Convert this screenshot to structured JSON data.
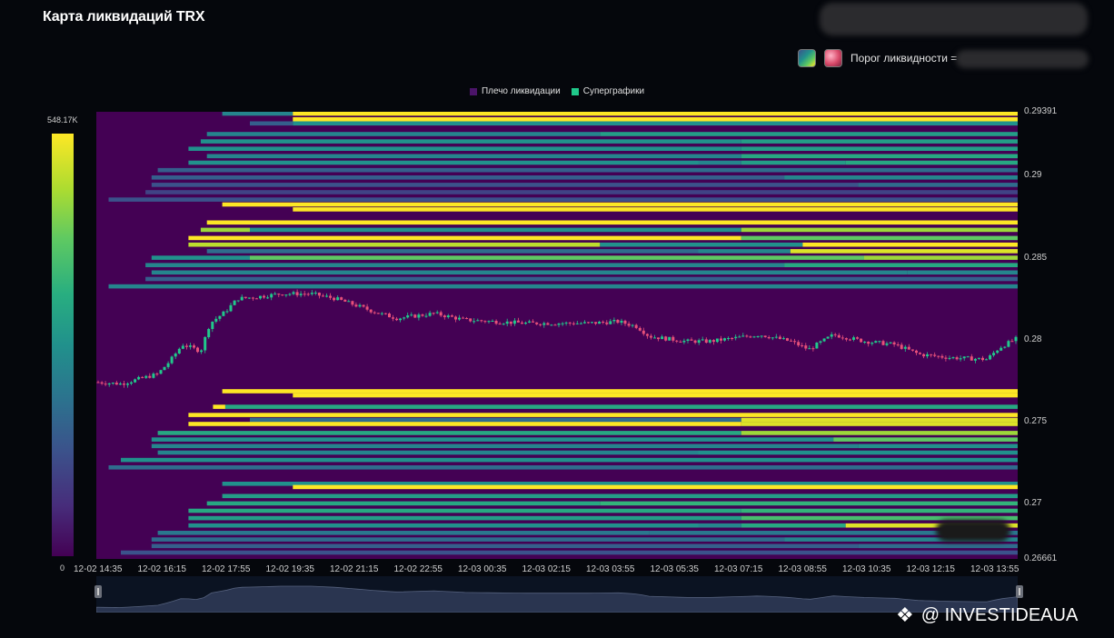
{
  "title": "Карта ликвидаций TRX",
  "threshold": {
    "label": "Порог ликвидности ="
  },
  "legend": [
    {
      "label": "Плечо ликвидации",
      "color": "#4b1469"
    },
    {
      "label": "Суперграфики",
      "color": "#20c98b"
    }
  ],
  "colorbar": {
    "max_label": "548.17K",
    "min_label": "0"
  },
  "watermark": {
    "text": "@ INVESTIDEAUA",
    "logo": "diamond-logo-icon"
  },
  "chart_data": {
    "type": "heatmap",
    "title": "Карта ликвидаций TRX",
    "y_range": [
      0.26661,
      0.29391
    ],
    "x_range_index": [
      0,
      15.0
    ],
    "xticks": [
      "12-02 14:35",
      "12-02 16:15",
      "12-02 17:55",
      "12-02 19:35",
      "12-02 21:15",
      "12-02 22:55",
      "12-03 00:35",
      "12-03 02:15",
      "12-03 03:55",
      "12-03 05:35",
      "12-03 07:15",
      "12-03 08:55",
      "12-03 10:35",
      "12-03 12:15",
      "12-03 13:55"
    ],
    "yticks": [
      {
        "label": "0.29391",
        "value": 0.29391
      },
      {
        "label": "0.29",
        "value": 0.29
      },
      {
        "label": "0.285",
        "value": 0.285
      },
      {
        "label": "0.28",
        "value": 0.28
      },
      {
        "label": "0.275",
        "value": 0.275
      },
      {
        "label": "0.27",
        "value": 0.27
      },
      {
        "label": "0.26661",
        "value": 0.26661
      }
    ],
    "colorscale": [
      "#440154",
      "#472d7b",
      "#3b528b",
      "#2c728e",
      "#21918c",
      "#28ae80",
      "#5ec962",
      "#addc30",
      "#fde725"
    ],
    "liquidation_levels": [
      {
        "price": 0.2938,
        "start": 2.05,
        "segments": [
          [
            2.05,
            0.45
          ],
          [
            3.2,
            1.0
          ]
        ]
      },
      {
        "price": 0.29345,
        "start": 3.2,
        "segments": [
          [
            3.2,
            1.0
          ]
        ]
      },
      {
        "price": 0.2932,
        "start": 2.5,
        "segments": [
          [
            2.5,
            0.3
          ],
          [
            3.2,
            0.5
          ]
        ]
      },
      {
        "price": 0.29255,
        "start": 1.8,
        "segments": [
          [
            1.8,
            0.45
          ],
          [
            8.2,
            0.55
          ]
        ]
      },
      {
        "price": 0.2921,
        "start": 1.7,
        "segments": [
          [
            1.7,
            0.5
          ],
          [
            10.5,
            0.55
          ]
        ]
      },
      {
        "price": 0.29165,
        "start": 1.5,
        "segments": [
          [
            1.5,
            0.5
          ],
          [
            10.5,
            0.55
          ]
        ]
      },
      {
        "price": 0.2912,
        "start": 1.8,
        "segments": [
          [
            1.8,
            0.45
          ],
          [
            10.5,
            0.6
          ]
        ]
      },
      {
        "price": 0.2908,
        "start": 1.5,
        "segments": [
          [
            1.5,
            0.5
          ],
          [
            9.8,
            0.45
          ],
          [
            10.5,
            0.55
          ],
          [
            12.2,
            0.6
          ]
        ]
      },
      {
        "price": 0.29035,
        "start": 1.0,
        "segments": [
          [
            1.0,
            0.3
          ],
          [
            9.0,
            0.35
          ]
        ]
      },
      {
        "price": 0.2899,
        "start": 0.9,
        "segments": [
          [
            0.9,
            0.3
          ],
          [
            11.2,
            0.45
          ]
        ]
      },
      {
        "price": 0.28945,
        "start": 0.9,
        "segments": [
          [
            0.9,
            0.25
          ],
          [
            12.4,
            0.35
          ]
        ]
      },
      {
        "price": 0.289,
        "start": 0.8,
        "segments": [
          [
            0.8,
            0.2
          ]
        ]
      },
      {
        "price": 0.28855,
        "start": 0.2,
        "segments": [
          [
            0.2,
            0.25
          ]
        ]
      },
      {
        "price": 0.28825,
        "start": 2.05,
        "segments": [
          [
            2.05,
            1.0
          ]
        ]
      },
      {
        "price": 0.28795,
        "start": 3.2,
        "segments": [
          [
            3.2,
            1.0
          ]
        ]
      },
      {
        "price": 0.28715,
        "start": 1.8,
        "segments": [
          [
            1.8,
            1.0
          ]
        ]
      },
      {
        "price": 0.2867,
        "start": 1.7,
        "segments": [
          [
            1.7,
            0.85
          ],
          [
            2.5,
            0.5
          ],
          [
            10.5,
            0.85
          ]
        ]
      },
      {
        "price": 0.2862,
        "start": 1.5,
        "segments": [
          [
            1.5,
            1.0
          ],
          [
            10.5,
            0.75
          ]
        ]
      },
      {
        "price": 0.2858,
        "start": 1.5,
        "segments": [
          [
            1.5,
            0.9
          ],
          [
            8.2,
            0.5
          ],
          [
            11.5,
            1.0
          ]
        ]
      },
      {
        "price": 0.2854,
        "start": 1.8,
        "segments": [
          [
            1.8,
            0.35
          ],
          [
            9.8,
            0.45
          ],
          [
            11.3,
            0.95
          ]
        ]
      },
      {
        "price": 0.285,
        "start": 0.9,
        "segments": [
          [
            0.9,
            0.5
          ],
          [
            2.5,
            0.75
          ],
          [
            12.5,
            0.85
          ]
        ]
      },
      {
        "price": 0.28455,
        "start": 0.8,
        "segments": [
          [
            0.8,
            0.45
          ],
          [
            11.2,
            0.6
          ]
        ]
      },
      {
        "price": 0.2841,
        "start": 0.9,
        "segments": [
          [
            0.9,
            0.45
          ],
          [
            13.2,
            0.45
          ]
        ]
      },
      {
        "price": 0.2837,
        "start": 0.8,
        "segments": [
          [
            0.8,
            0.3
          ]
        ]
      },
      {
        "price": 0.28325,
        "start": 0.2,
        "segments": [
          [
            0.2,
            0.45
          ]
        ]
      },
      {
        "price": 0.27685,
        "start": 2.05,
        "segments": [
          [
            2.05,
            1.0
          ]
        ]
      },
      {
        "price": 0.2766,
        "start": 3.2,
        "segments": [
          [
            3.2,
            1.0
          ]
        ]
      },
      {
        "price": 0.2759,
        "start": 1.9,
        "segments": [
          [
            1.9,
            1.0
          ],
          [
            2.1,
            0.6
          ]
        ]
      },
      {
        "price": 0.2754,
        "start": 1.5,
        "segments": [
          [
            1.5,
            1.0
          ]
        ]
      },
      {
        "price": 0.2751,
        "start": 2.5,
        "segments": [
          [
            2.5,
            0.35
          ],
          [
            10.5,
            0.95
          ]
        ]
      },
      {
        "price": 0.27485,
        "start": 1.5,
        "segments": [
          [
            1.5,
            1.0
          ],
          [
            10.5,
            0.95
          ]
        ]
      },
      {
        "price": 0.2743,
        "start": 1.0,
        "segments": [
          [
            1.0,
            0.6
          ],
          [
            10.5,
            0.85
          ]
        ]
      },
      {
        "price": 0.2739,
        "start": 0.9,
        "segments": [
          [
            0.9,
            0.5
          ],
          [
            12.0,
            0.75
          ]
        ]
      },
      {
        "price": 0.2735,
        "start": 0.9,
        "segments": [
          [
            0.9,
            0.45
          ],
          [
            12.4,
            0.5
          ]
        ]
      },
      {
        "price": 0.2731,
        "start": 1.0,
        "segments": [
          [
            1.0,
            0.45
          ],
          [
            9.8,
            0.5
          ]
        ]
      },
      {
        "price": 0.27265,
        "start": 0.4,
        "segments": [
          [
            0.4,
            0.5
          ]
        ]
      },
      {
        "price": 0.2722,
        "start": 0.2,
        "segments": [
          [
            0.2,
            0.35
          ]
        ]
      },
      {
        "price": 0.2712,
        "start": 2.05,
        "segments": [
          [
            2.05,
            0.5
          ]
        ]
      },
      {
        "price": 0.271,
        "start": 3.2,
        "segments": [
          [
            3.2,
            1.0
          ]
        ]
      },
      {
        "price": 0.27045,
        "start": 2.05,
        "segments": [
          [
            2.05,
            0.55
          ]
        ]
      },
      {
        "price": 0.27,
        "start": 1.8,
        "segments": [
          [
            1.8,
            0.6
          ],
          [
            8.2,
            0.65
          ]
        ]
      },
      {
        "price": 0.26955,
        "start": 1.5,
        "segments": [
          [
            1.5,
            0.6
          ],
          [
            10.5,
            0.65
          ]
        ]
      },
      {
        "price": 0.2691,
        "start": 1.5,
        "segments": [
          [
            1.5,
            0.55
          ],
          [
            10.5,
            0.7
          ]
        ]
      },
      {
        "price": 0.26865,
        "start": 1.5,
        "segments": [
          [
            1.5,
            0.5
          ],
          [
            9.8,
            0.45
          ],
          [
            10.5,
            0.6
          ],
          [
            12.2,
            0.95
          ]
        ]
      },
      {
        "price": 0.2682,
        "start": 1.0,
        "segments": [
          [
            1.0,
            0.4
          ],
          [
            9.0,
            0.4
          ]
        ]
      },
      {
        "price": 0.2678,
        "start": 0.9,
        "segments": [
          [
            0.9,
            0.35
          ],
          [
            11.2,
            0.45
          ]
        ]
      },
      {
        "price": 0.2674,
        "start": 0.9,
        "segments": [
          [
            0.9,
            0.3
          ],
          [
            12.4,
            0.35
          ]
        ]
      },
      {
        "price": 0.267,
        "start": 0.4,
        "segments": [
          [
            0.4,
            0.25
          ]
        ]
      }
    ],
    "price_candles": {
      "keypoints": [
        [
          0,
          0.2774
        ],
        [
          0.4,
          0.2773
        ],
        [
          0.8,
          0.2777
        ],
        [
          1.0,
          0.2779
        ],
        [
          1.2,
          0.2787
        ],
        [
          1.4,
          0.2797
        ],
        [
          1.7,
          0.2793
        ],
        [
          1.85,
          0.281
        ],
        [
          2.1,
          0.2817
        ],
        [
          2.3,
          0.2825
        ],
        [
          2.6,
          0.2826
        ],
        [
          3.0,
          0.2828
        ],
        [
          3.5,
          0.2828
        ],
        [
          3.9,
          0.2825
        ],
        [
          4.3,
          0.282
        ],
        [
          4.6,
          0.2816
        ],
        [
          4.9,
          0.2813
        ],
        [
          5.5,
          0.2816
        ],
        [
          6.0,
          0.2812
        ],
        [
          7.0,
          0.281
        ],
        [
          8.0,
          0.281
        ],
        [
          8.5,
          0.2811
        ],
        [
          8.8,
          0.2808
        ],
        [
          9.0,
          0.2802
        ],
        [
          9.6,
          0.2799
        ],
        [
          10.0,
          0.2799
        ],
        [
          10.4,
          0.2801
        ],
        [
          10.8,
          0.2803
        ],
        [
          11.3,
          0.2799
        ],
        [
          11.6,
          0.2794
        ],
        [
          12.0,
          0.2803
        ],
        [
          12.5,
          0.2799
        ],
        [
          13.0,
          0.2797
        ],
        [
          13.4,
          0.2791
        ],
        [
          13.9,
          0.2789
        ],
        [
          14.5,
          0.2788
        ],
        [
          14.7,
          0.2795
        ],
        [
          15.0,
          0.2801
        ]
      ],
      "up_color": "#20c98b",
      "down_color": "#e8507a"
    }
  }
}
